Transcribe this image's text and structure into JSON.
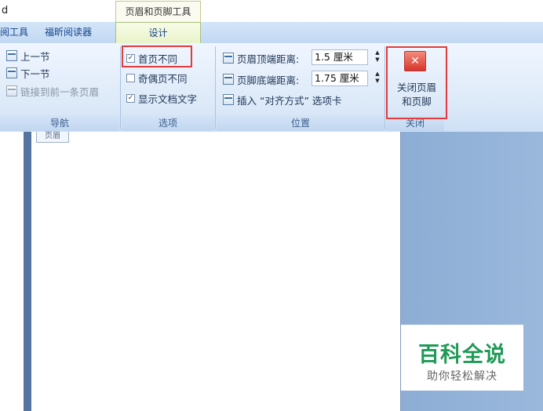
{
  "titlebar": {
    "title_fragment": "d",
    "context_group": "页眉和页脚工具"
  },
  "tabs": {
    "review": "阅工具",
    "fuxin": "福昕阅读器",
    "design": "设计"
  },
  "navigation": {
    "previous_section": "上一节",
    "next_section": "下一节",
    "link_to_previous": "链接到前一条页眉",
    "group_label": "导航"
  },
  "options": {
    "different_first_page": {
      "label": "首页不同",
      "checked": true
    },
    "different_odd_even": {
      "label": "奇偶页不同",
      "checked": false
    },
    "show_document_text": {
      "label": "显示文档文字",
      "checked": true
    },
    "group_label": "选项",
    "check_mark": "✓"
  },
  "position": {
    "header_from_top": {
      "label": "页眉顶端距离:",
      "value": "1.5 厘米"
    },
    "footer_from_bottom": {
      "label": "页脚底端距离:",
      "value": "1.75 厘米"
    },
    "insert_alignment_tab": "插入 “对齐方式” 选项卡",
    "group_label": "位置",
    "spin_up": "▲",
    "spin_down": "▼"
  },
  "close": {
    "button_line1": "关闭页眉",
    "button_line2": "和页脚",
    "group_label": "关闭",
    "icon_glyph": "✕"
  },
  "document": {
    "header_tag": "页眉"
  },
  "watermark": {
    "title": "百科全说",
    "subtitle": "助你轻松解决"
  },
  "colors": {
    "highlight_border": "#e23c3c",
    "watermark_green": "#1f9a57",
    "workspace_blue": "#7d9fcb"
  }
}
